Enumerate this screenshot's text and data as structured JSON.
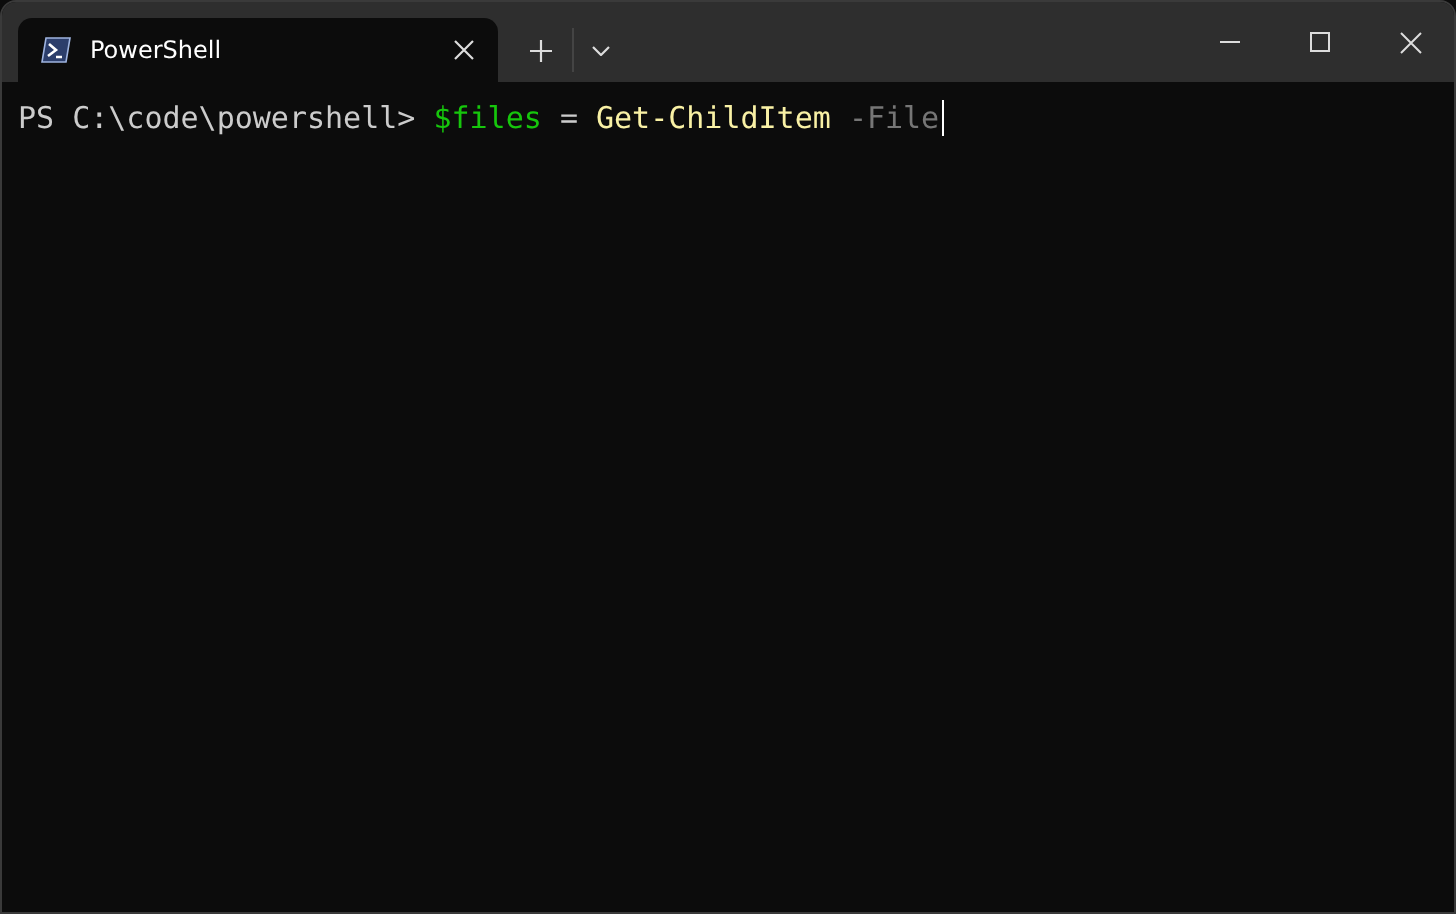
{
  "tabs": [
    {
      "title": "PowerShell",
      "selected": true
    }
  ],
  "terminal": {
    "lines": [
      {
        "tokens": [
          {
            "kind": "prompt",
            "text": "PS C:\\code\\powershell>"
          },
          {
            "kind": "variable",
            "text": "$files"
          },
          {
            "kind": "operator",
            "text": "="
          },
          {
            "kind": "command",
            "text": "Get-ChildItem"
          },
          {
            "kind": "parameter",
            "text": "-File"
          }
        ],
        "cursor": true
      }
    ]
  }
}
